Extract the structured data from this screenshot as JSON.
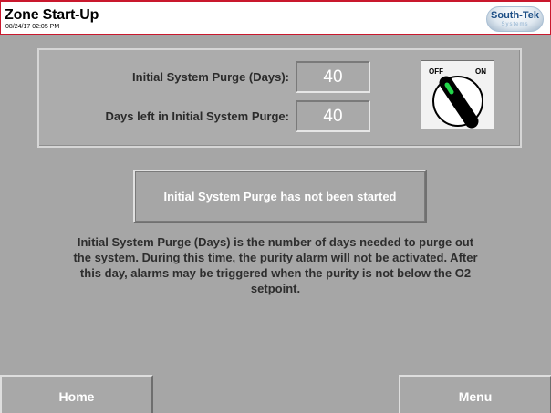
{
  "header": {
    "title": "Zone Start-Up",
    "timestamp": "08/24/17  02:05 PM",
    "logo": {
      "main": "South-Tek",
      "sub": "Systems"
    }
  },
  "purge": {
    "initial_label": "Initial System Purge (Days):",
    "initial_value": "40",
    "days_left_label": "Days left in Initial System Purge:",
    "days_left_value": "40",
    "switch": {
      "off_label": "OFF",
      "on_label": "ON",
      "state": "off"
    }
  },
  "status": {
    "message": "Initial System Purge has not been started"
  },
  "description": "Initial System Purge (Days) is the number of days needed to purge out the system. During this time, the purity alarm will not be activated. After this day, alarms may be triggered when the purity is not below the O2 setpoint.",
  "nav": {
    "home_label": "Home",
    "menu_label": "Menu"
  },
  "colors": {
    "background": "#a6a6a6",
    "header_border": "#c9182d",
    "switch_indicator": "#22d64a",
    "logo_text": "#1d4f86"
  }
}
